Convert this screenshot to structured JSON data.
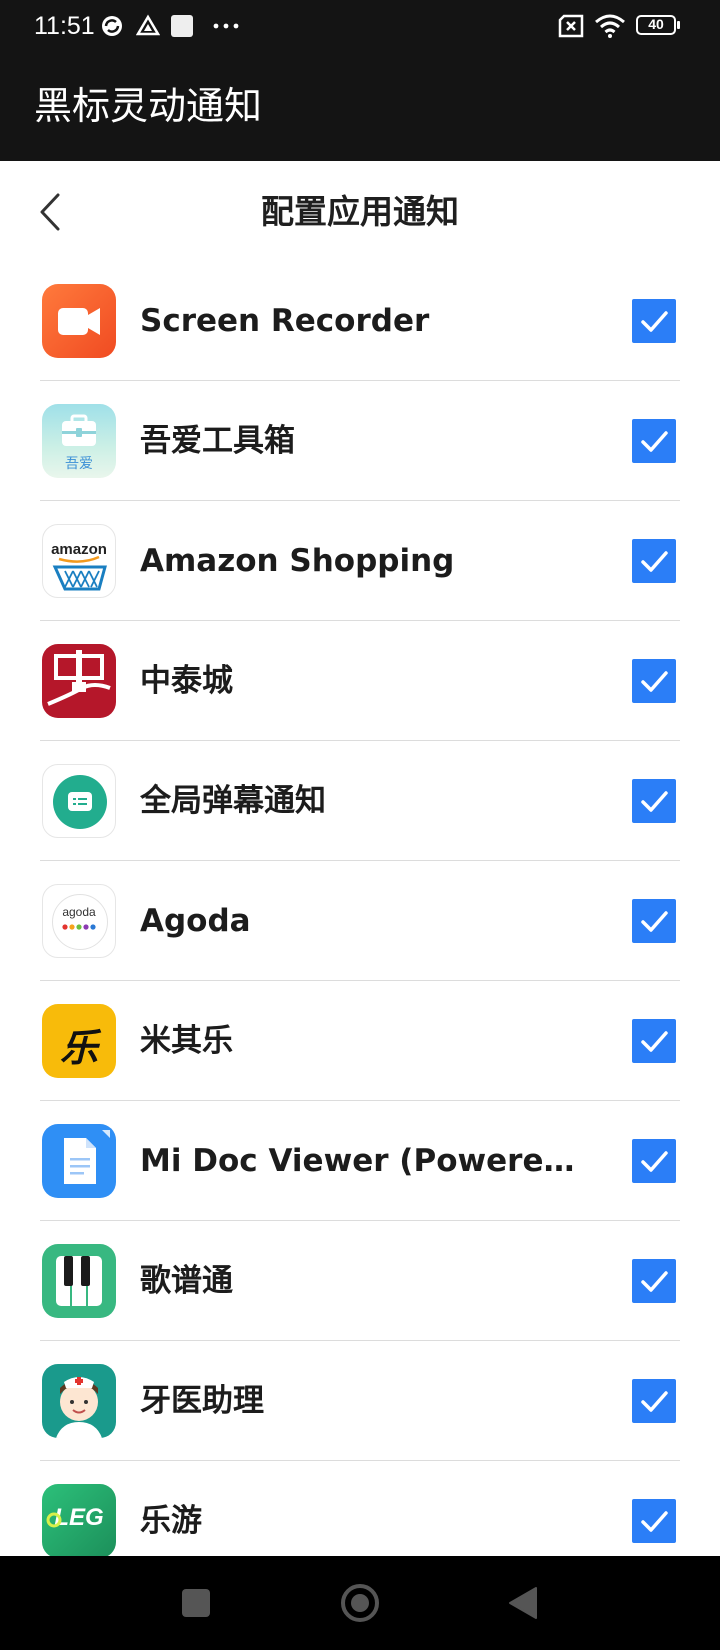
{
  "status_bar": {
    "time": "11:51",
    "battery": "40"
  },
  "app_bar": {
    "title": "黑标灵动通知"
  },
  "page": {
    "title": "配置应用通知"
  },
  "apps": [
    {
      "name": "Screen Recorder",
      "checked": true,
      "icon": "screen-recorder-icon"
    },
    {
      "name": "吾爱工具箱",
      "checked": true,
      "icon": "toolbox-icon"
    },
    {
      "name": "Amazon Shopping",
      "checked": true,
      "icon": "amazon-icon",
      "icon_text": "amazon"
    },
    {
      "name": "中泰城",
      "checked": true,
      "icon": "zhongtaicheng-icon"
    },
    {
      "name": "全局弹幕通知",
      "checked": true,
      "icon": "danmaku-icon"
    },
    {
      "name": "Agoda",
      "checked": true,
      "icon": "agoda-icon",
      "icon_text": "agoda"
    },
    {
      "name": "米其乐",
      "checked": true,
      "icon": "miqile-icon",
      "icon_text": "乐"
    },
    {
      "name": "Mi Doc Viewer (Powered by W...",
      "checked": true,
      "icon": "mi-doc-viewer-icon"
    },
    {
      "name": "歌谱通",
      "checked": true,
      "icon": "piano-icon"
    },
    {
      "name": "牙医助理",
      "checked": true,
      "icon": "dentist-icon"
    },
    {
      "name": "乐游",
      "checked": true,
      "icon": "leyou-icon",
      "icon_text": "LEG"
    }
  ],
  "colors": {
    "accent": "#2b7ef7",
    "bar": "#141414"
  }
}
